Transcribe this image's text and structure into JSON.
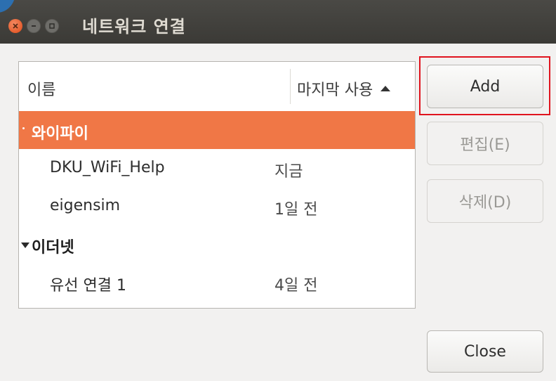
{
  "window": {
    "title": "네트워크 연결"
  },
  "list": {
    "columns": {
      "name": "이름",
      "last_used": "마지막 사용"
    },
    "groups": [
      {
        "label": "와이파이",
        "items": [
          {
            "name": "DKU_WiFi_Help",
            "last_used": "지금"
          },
          {
            "name": "eigensim",
            "last_used": "1일 전"
          }
        ]
      },
      {
        "label": "이더넷",
        "items": [
          {
            "name": "유선 연결 1",
            "last_used": "4일 전"
          }
        ]
      }
    ]
  },
  "buttons": {
    "add": "Add",
    "edit": "편집(E)",
    "delete": "삭제(D)",
    "close": "Close"
  },
  "colors": {
    "selection": "#f07746",
    "highlight_box": "#e0141e",
    "titlebar": "#3b3a36"
  }
}
